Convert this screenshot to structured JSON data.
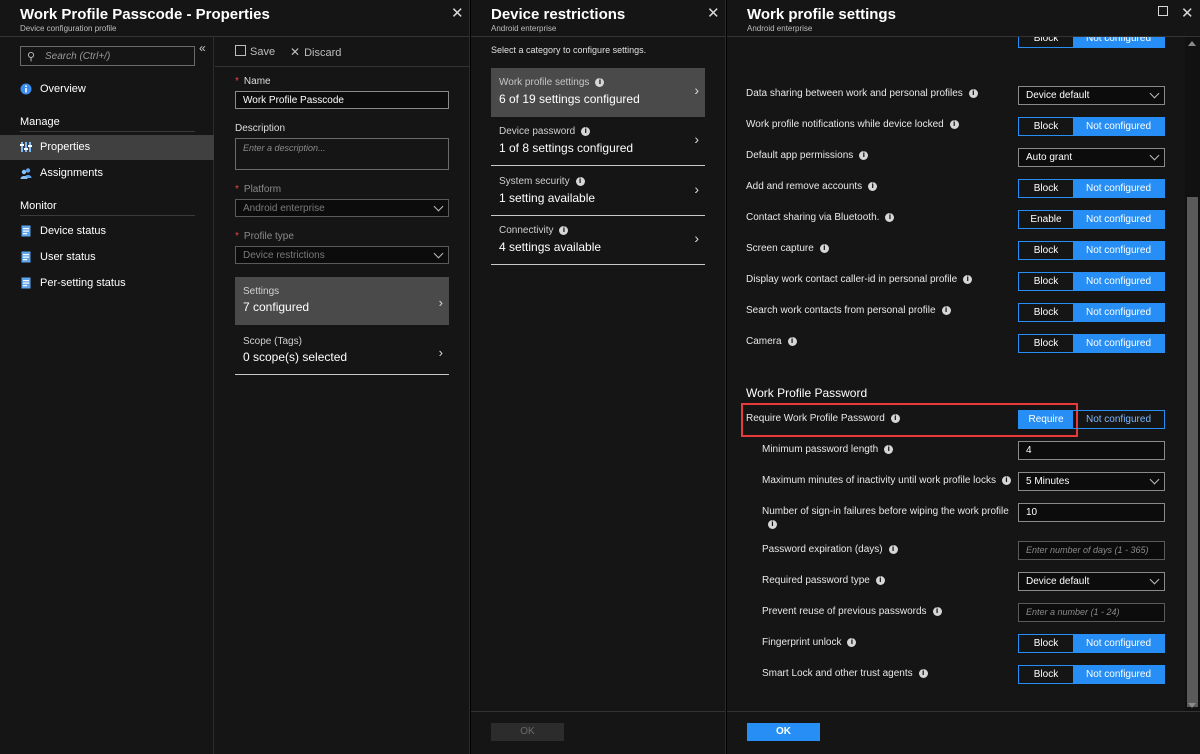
{
  "blade1": {
    "title": "Work Profile Passcode - Properties",
    "subtitle": "Device configuration profile",
    "search_placeholder": "Search (Ctrl+/)",
    "collapse": "«",
    "nav": {
      "overview": "Overview",
      "manage_group": "Manage",
      "properties": "Properties",
      "assignments": "Assignments",
      "monitor_group": "Monitor",
      "device_status": "Device status",
      "user_status": "User status",
      "per_setting_status": "Per-setting status"
    },
    "toolbar": {
      "save": "Save",
      "discard": "Discard"
    },
    "form": {
      "name_label": "Name",
      "name_value": "Work Profile Passcode",
      "description_label": "Description",
      "description_placeholder": "Enter a description...",
      "platform_label": "Platform",
      "platform_value": "Android enterprise",
      "profile_type_label": "Profile type",
      "profile_type_value": "Device restrictions",
      "settings_label": "Settings",
      "settings_value": "7 configured",
      "scope_label": "Scope (Tags)",
      "scope_value": "0 scope(s) selected"
    }
  },
  "blade2": {
    "title": "Device restrictions",
    "subtitle": "Android enterprise",
    "intro": "Select a category to configure settings.",
    "categories": [
      {
        "label": "Work profile settings",
        "value": "6 of 19 settings configured"
      },
      {
        "label": "Device password",
        "value": "1 of 8 settings configured"
      },
      {
        "label": "System security",
        "value": "1 setting available"
      },
      {
        "label": "Connectivity",
        "value": "4 settings available"
      }
    ],
    "ok": "OK"
  },
  "blade3": {
    "title": "Work profile settings",
    "subtitle": "Android enterprise",
    "top_partial": {
      "left": "Block",
      "right": "Not configured"
    },
    "rows": [
      {
        "label": "Data sharing between work and personal profiles",
        "value": "Device default"
      },
      {
        "label": "Work profile notifications while device locked",
        "left": "Block",
        "right": "Not configured"
      },
      {
        "label": "Default app permissions",
        "value": "Auto grant"
      },
      {
        "label": "Add and remove accounts",
        "left": "Block",
        "right": "Not configured"
      },
      {
        "label": "Contact sharing via Bluetooth.",
        "left": "Enable",
        "right": "Not configured"
      },
      {
        "label": "Screen capture",
        "left": "Block",
        "right": "Not configured"
      },
      {
        "label": "Display work contact caller-id in personal profile",
        "left": "Block",
        "right": "Not configured"
      },
      {
        "label": "Search work contacts from personal profile",
        "left": "Block",
        "right": "Not configured"
      },
      {
        "label": "Camera",
        "left": "Block",
        "right": "Not configured"
      }
    ],
    "password_section": "Work Profile Password",
    "require": {
      "label": "Require Work Profile Password",
      "left": "Require",
      "right": "Not configured"
    },
    "pw_rows": [
      {
        "label": "Minimum password length",
        "value": "4"
      },
      {
        "label": "Maximum minutes of inactivity until work profile locks",
        "value": "5 Minutes"
      },
      {
        "label": "Number of sign-in failures before wiping the work profile",
        "value": "10"
      },
      {
        "label": "Password expiration (days)",
        "placeholder": "Enter number of days (1 - 365)"
      },
      {
        "label": "Required password type",
        "value": "Device default"
      },
      {
        "label": "Prevent reuse of previous passwords",
        "placeholder": "Enter a number (1 - 24)"
      },
      {
        "label": "Fingerprint unlock",
        "left": "Block",
        "right": "Not configured"
      },
      {
        "label": "Smart Lock and other trust agents",
        "left": "Block",
        "right": "Not configured"
      }
    ],
    "ok": "OK"
  },
  "colors": {
    "accent": "#268ef5",
    "highlight": "#e83a3a",
    "panel": "#151515"
  }
}
